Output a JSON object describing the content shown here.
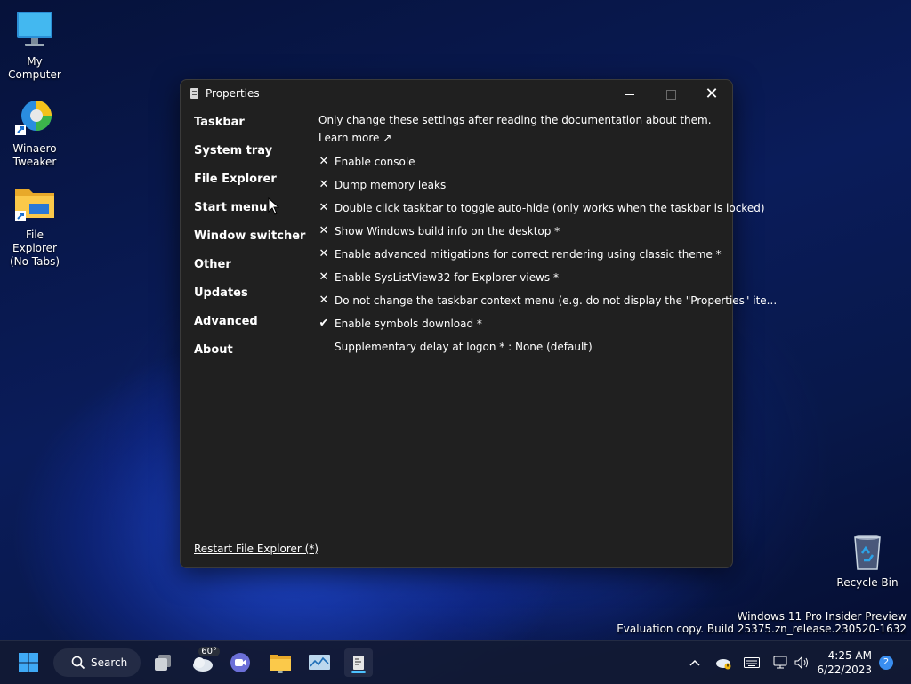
{
  "desktop": {
    "icons": [
      {
        "label": "My Computer"
      },
      {
        "label": "Winaero Tweaker"
      },
      {
        "label": "File Explorer (No Tabs)"
      },
      {
        "label": "Recycle Bin"
      }
    ],
    "watermark": {
      "line1": "Windows 11 Pro Insider Preview",
      "line2": "Evaluation copy. Build 25375.zn_release.230520-1632"
    }
  },
  "window": {
    "title": "Properties",
    "nav": [
      {
        "label": "Taskbar"
      },
      {
        "label": "System tray"
      },
      {
        "label": "File Explorer"
      },
      {
        "label": "Start menu"
      },
      {
        "label": "Window switcher"
      },
      {
        "label": "Other"
      },
      {
        "label": "Updates"
      },
      {
        "label": "Advanced",
        "active": true
      },
      {
        "label": "About"
      }
    ],
    "intro": "Only change these settings after reading the documentation about them.",
    "learn_more": "Learn more ↗",
    "options": [
      {
        "mark": "✕",
        "label": "Enable console"
      },
      {
        "mark": "✕",
        "label": "Dump memory leaks"
      },
      {
        "mark": "✕",
        "label": "Double click taskbar to toggle auto-hide (only works when the taskbar is locked)"
      },
      {
        "mark": "✕",
        "label": "Show Windows build info on the desktop *"
      },
      {
        "mark": "✕",
        "label": "Enable advanced mitigations for correct rendering using classic theme *"
      },
      {
        "mark": "✕",
        "label": "Enable SysListView32 for Explorer views *"
      },
      {
        "mark": "✕",
        "label": "Do not change the taskbar context menu (e.g. do not display the \"Properties\" ite..."
      },
      {
        "mark": "✔",
        "label": "Enable symbols download *"
      },
      {
        "mark": "",
        "label": "Supplementary delay at logon * : None (default)"
      }
    ],
    "restart_link": "Restart File Explorer (*)"
  },
  "taskbar": {
    "search_label": "Search",
    "weather_temp": "60°",
    "time": "4:25 AM",
    "date": "6/22/2023",
    "notification_count": "2",
    "icons": [
      "windows-start-icon",
      "search-icon",
      "task-view-icon",
      "weather-icon",
      "teams-chat-icon",
      "file-explorer-icon",
      "monitor-app-icon",
      "properties-app-icon"
    ],
    "tray_icons": [
      "chevron-up-icon",
      "onedrive-icon",
      "keyboard-icon",
      "network-icon",
      "volume-icon"
    ]
  },
  "colors": {
    "window_bg": "#202020",
    "taskbar_bg": "#121a34",
    "accent": "#4cc2ff",
    "badge": "#3a8ef0"
  }
}
